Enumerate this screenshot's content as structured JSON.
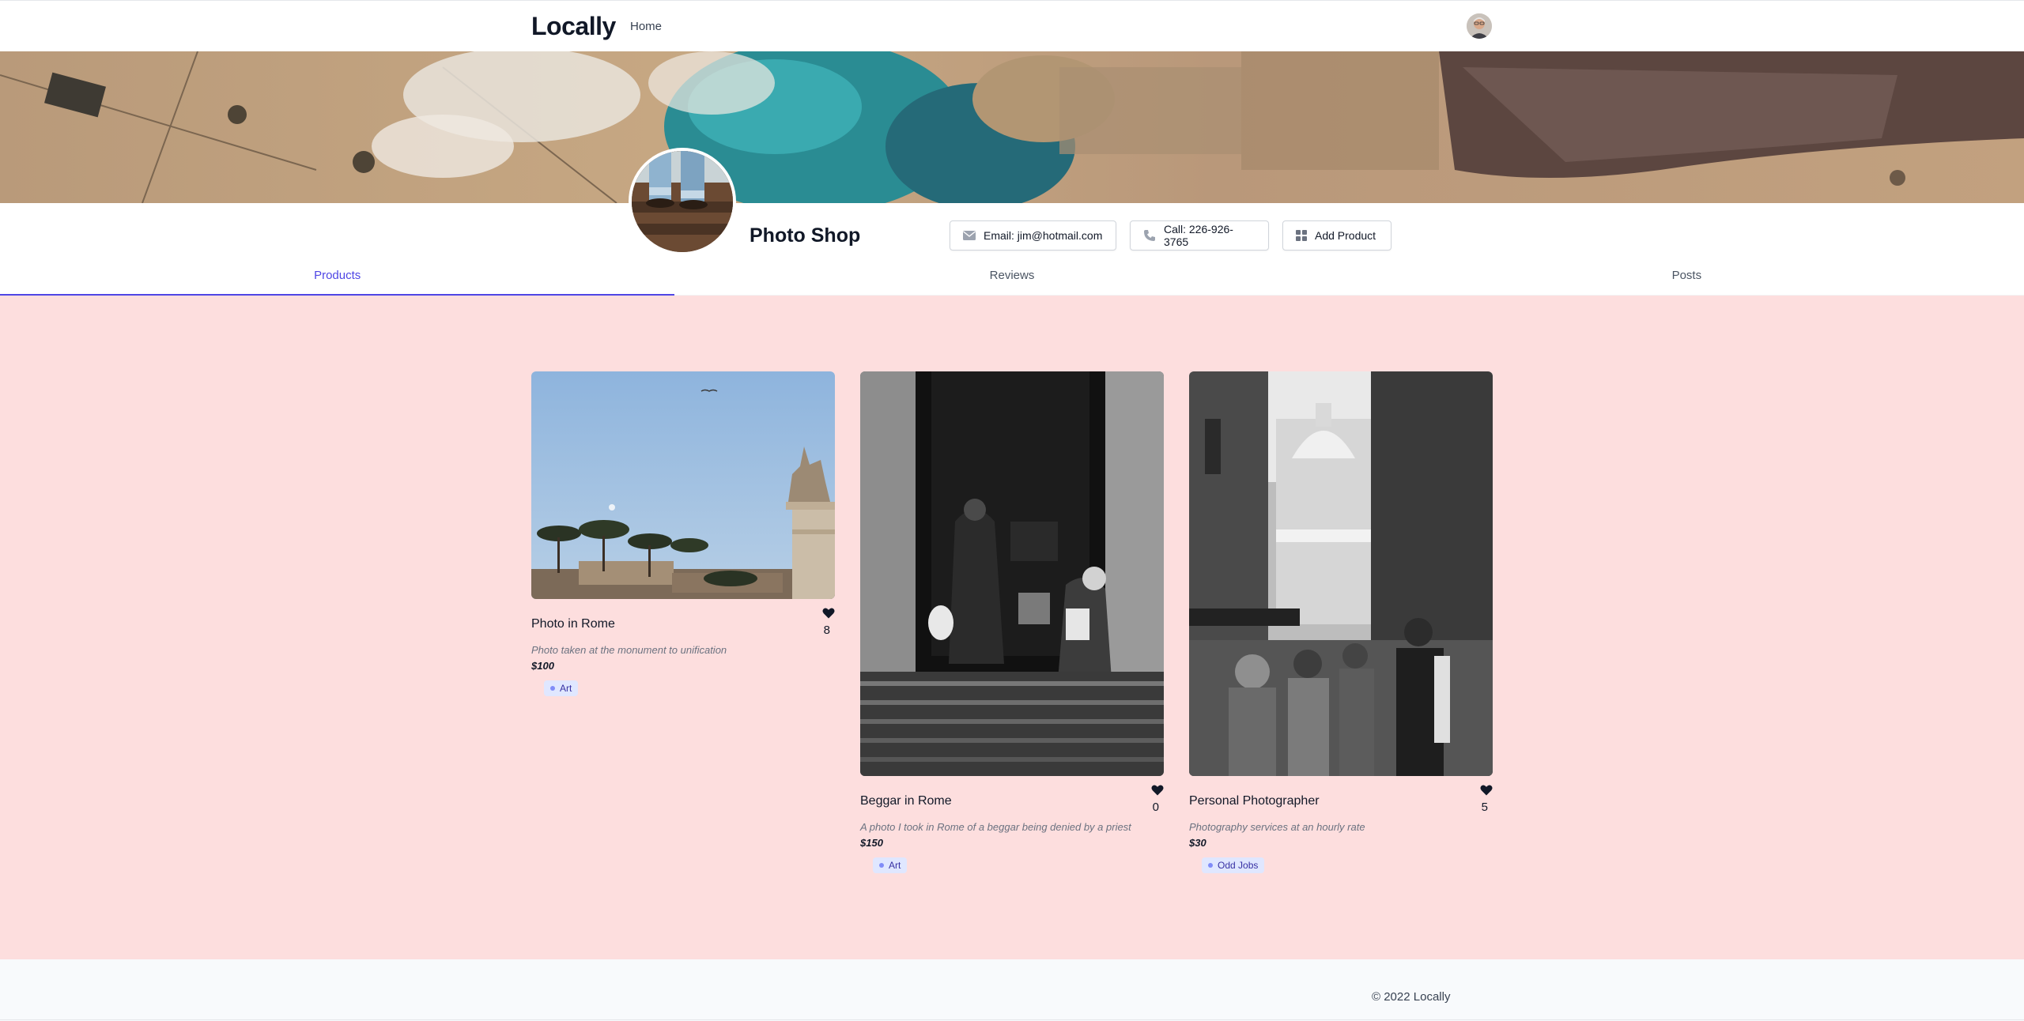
{
  "nav": {
    "brand": "Locally",
    "home_label": "Home",
    "avatar_icon": "user-avatar"
  },
  "shop": {
    "name": "Photo Shop",
    "email_label": "Email: jim@hotmail.com",
    "call_label": "Call: 226-926-3765",
    "add_product_label": "Add Product"
  },
  "tabs": [
    {
      "label": "Products",
      "active": true
    },
    {
      "label": "Reviews",
      "active": false
    },
    {
      "label": "Posts",
      "active": false
    }
  ],
  "products": [
    {
      "title": "Photo in Rome",
      "likes": "8",
      "description": "Photo taken at the monument to unification",
      "price": "$100",
      "tag": "Art"
    },
    {
      "title": "Beggar in Rome",
      "likes": "0",
      "description": "A photo I took in Rome of a beggar being denied by a priest",
      "price": "$150",
      "tag": "Art"
    },
    {
      "title": "Personal Photographer",
      "likes": "5",
      "description": "Photography services at an hourly rate",
      "price": "$30",
      "tag": "Odd Jobs"
    }
  ],
  "footer": {
    "copyright": "© 2022 Locally"
  },
  "colors": {
    "accent": "#4f46e5",
    "page_background": "#fddede",
    "tag_background": "#e0e7ff"
  }
}
